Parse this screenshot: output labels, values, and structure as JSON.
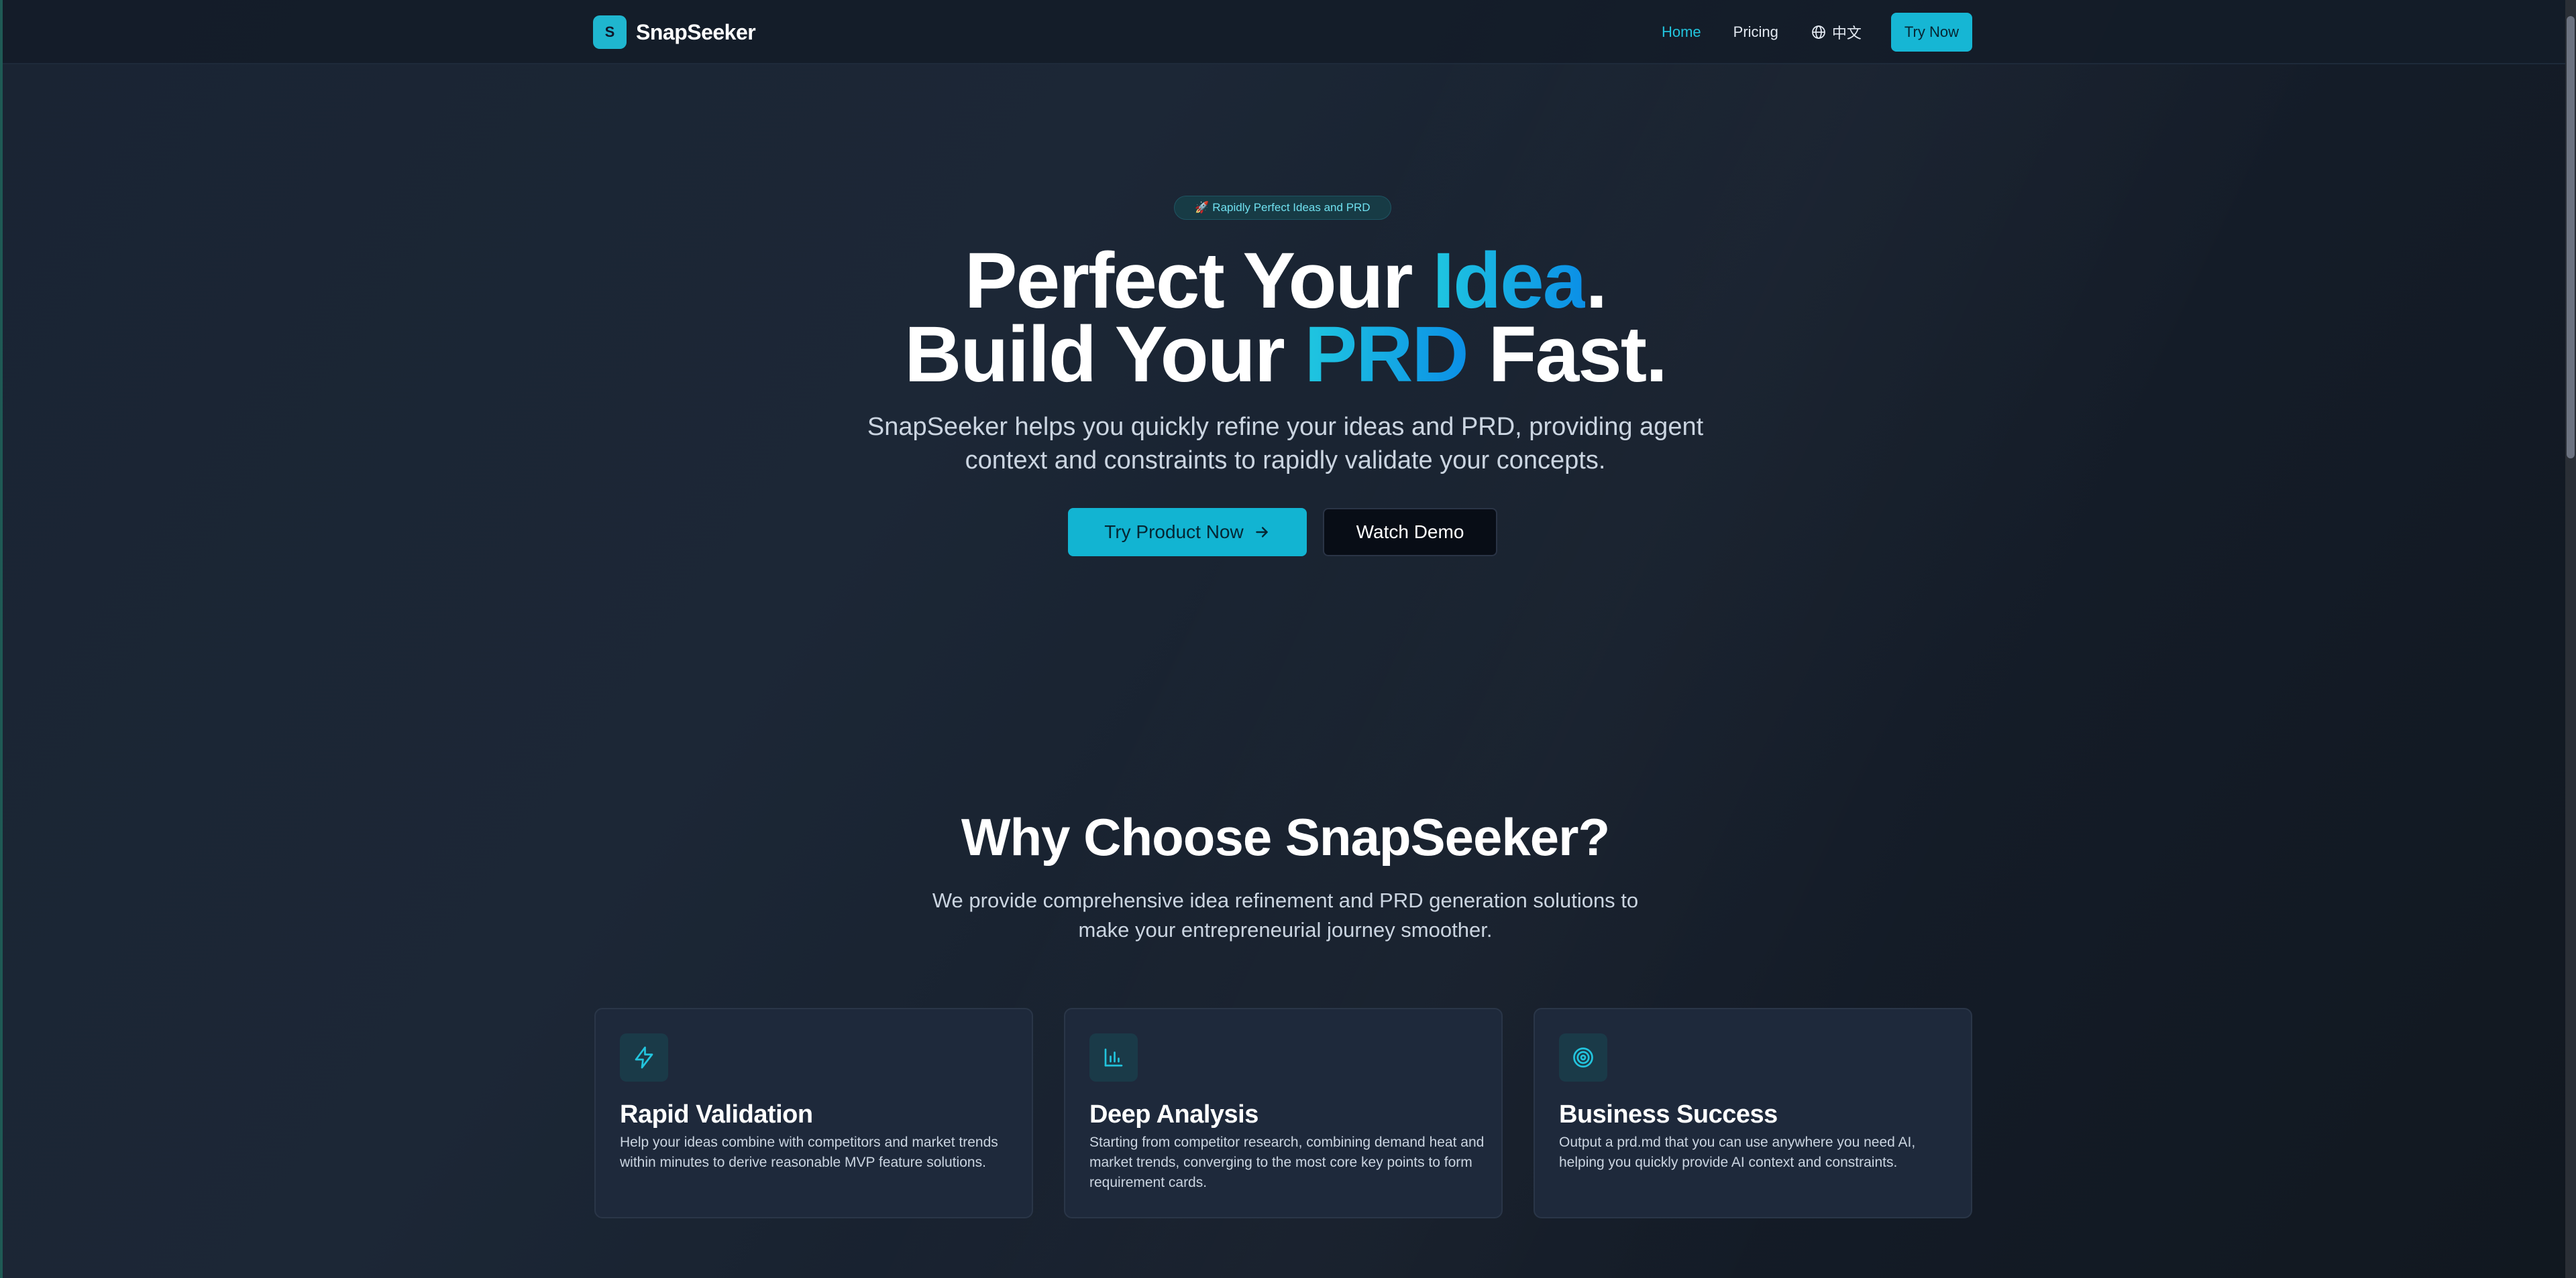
{
  "nav": {
    "brand_initial": "S",
    "brand_name": "SnapSeeker",
    "links": [
      "Home",
      "Pricing"
    ],
    "language": "中文",
    "cta": "Try Now"
  },
  "hero": {
    "badge_icon": "rocket-icon",
    "badge_text": "🚀 Rapidly Perfect Ideas and PRD",
    "line1_pre": "Perfect Your ",
    "line1_accent": "Idea",
    "line1_post": ".",
    "line2_pre": "Build Your ",
    "line2_accent": "PRD",
    "line2_post": " Fast.",
    "subtitle_line1": "SnapSeeker helps you quickly refine your ideas and PRD, providing agent",
    "subtitle_line2": "context and constraints to rapidly validate your concepts.",
    "primary_button": "Try Product Now",
    "secondary_button": "Watch Demo"
  },
  "why": {
    "title": "Why Choose SnapSeeker?",
    "subtitle_line1": "We provide comprehensive idea refinement and PRD generation solutions to",
    "subtitle_line2": "make your entrepreneurial journey smoother.",
    "cards": [
      {
        "icon": "lightning-icon",
        "title": "Rapid Validation",
        "description": "Help your ideas combine with competitors and market trends within minutes to derive reasonable MVP feature solutions."
      },
      {
        "icon": "bar-chart-icon",
        "title": "Deep Analysis",
        "description": "Starting from competitor research, combining demand heat and market trends, converging to the most core key points to form requirement cards."
      },
      {
        "icon": "target-icon",
        "title": "Business Success",
        "description": "Output a prd.md that you can use anywhere you need AI, helping you quickly provide AI context and constraints."
      }
    ]
  },
  "colors": {
    "accent": "#16b6d4",
    "background": "#1a2433",
    "card": "#1e293b"
  }
}
